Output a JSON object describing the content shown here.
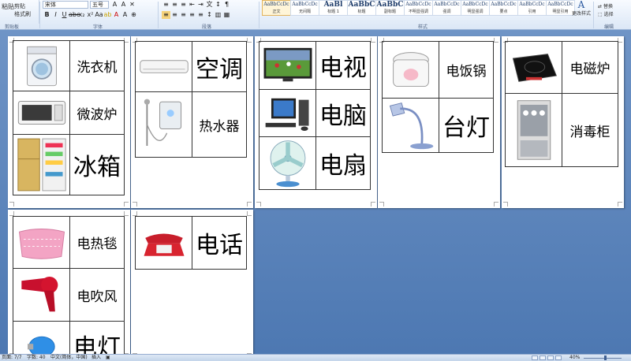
{
  "ribbon": {
    "clipboard": {
      "paste_label": "粘贴",
      "cut_label": "剪贴",
      "format_painter_label": "格式刷",
      "group_label": "剪贴板"
    },
    "font": {
      "font_name": "宋体",
      "font_size": "五号",
      "group_label": "字体"
    },
    "paragraph": {
      "group_label": "段落"
    },
    "styles": {
      "group_label": "样式",
      "items": [
        {
          "sample": "AaBbCcDc",
          "name": "正文"
        },
        {
          "sample": "AaBbCcDc",
          "name": "无间隔"
        },
        {
          "sample": "AaBl",
          "name": "标题 1"
        },
        {
          "sample": "AaBbC",
          "name": "标题"
        },
        {
          "sample": "AaBbC",
          "name": "副标题"
        },
        {
          "sample": "AaBbCcDc",
          "name": "不明显强调"
        },
        {
          "sample": "AaBbCcDc",
          "name": "强调"
        },
        {
          "sample": "AaBbCcDc",
          "name": "明显强调"
        },
        {
          "sample": "AaBbCcDc",
          "name": "要点"
        },
        {
          "sample": "AaBbCcDc",
          "name": "引用"
        },
        {
          "sample": "AaBbCcDc",
          "name": "明显引用"
        }
      ],
      "change_styles_label": "更改样式"
    },
    "editing": {
      "replace_label": "替换",
      "select_label": "选择",
      "group_label": "编辑"
    }
  },
  "pages": [
    {
      "items": [
        {
          "icon": "washing-machine-icon",
          "label": "洗衣机"
        },
        {
          "icon": "microwave-icon",
          "label": "微波炉"
        },
        {
          "icon": "refrigerator-icon",
          "label": "冰箱"
        }
      ]
    },
    {
      "items": [
        {
          "icon": "air-conditioner-icon",
          "label": "空调"
        },
        {
          "icon": "water-heater-icon",
          "label": "热水器"
        }
      ]
    },
    {
      "items": [
        {
          "icon": "television-icon",
          "label": "电视"
        },
        {
          "icon": "computer-icon",
          "label": "电脑"
        },
        {
          "icon": "electric-fan-icon",
          "label": "电扇"
        }
      ]
    },
    {
      "items": [
        {
          "icon": "rice-cooker-icon",
          "label": "电饭锅"
        },
        {
          "icon": "desk-lamp-icon",
          "label": "台灯"
        }
      ]
    },
    {
      "items": [
        {
          "icon": "induction-cooker-icon",
          "label": "电磁炉"
        },
        {
          "icon": "disinfection-cabinet-icon",
          "label": "消毒柜"
        }
      ]
    },
    {
      "items": [
        {
          "icon": "electric-blanket-icon",
          "label": "电热毯"
        },
        {
          "icon": "hair-dryer-icon",
          "label": "电吹风"
        },
        {
          "icon": "light-bulb-icon",
          "label": "电灯"
        }
      ]
    },
    {
      "items": [
        {
          "icon": "telephone-icon",
          "label": "电话"
        }
      ]
    }
  ],
  "status": {
    "page": "页面: 7/7",
    "words": "字数: 40",
    "language": "中文(简体，中国)",
    "insert": "插入",
    "zoom": "40%"
  }
}
